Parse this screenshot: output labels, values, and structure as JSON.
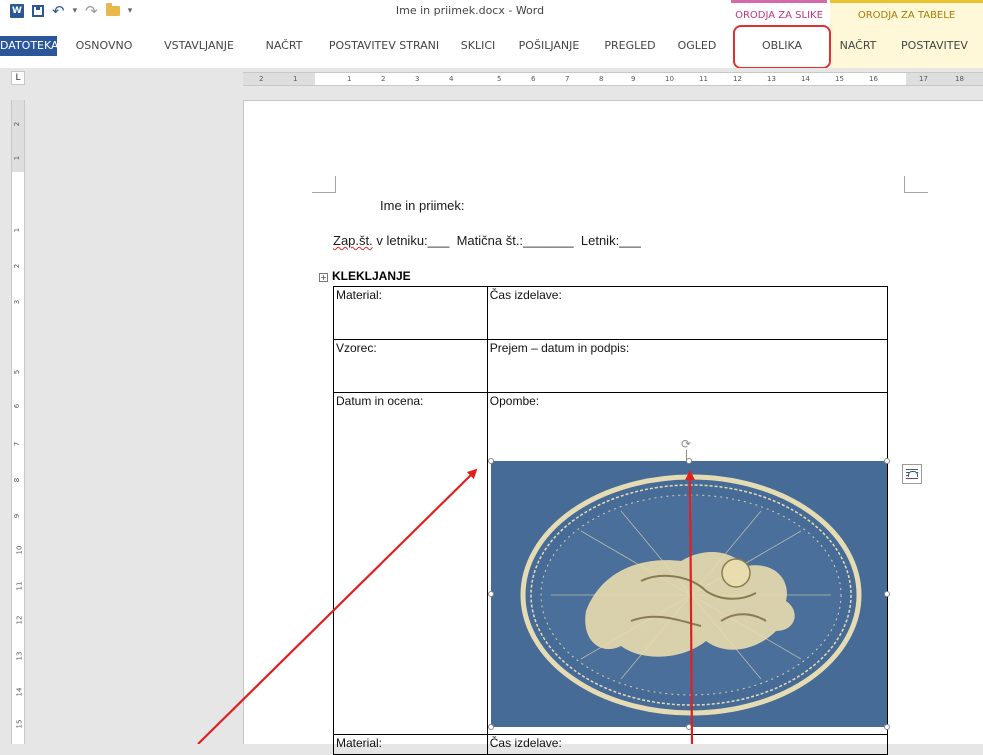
{
  "window": {
    "title": "Ime in priimek.docx - Word"
  },
  "quick_access": [
    {
      "name": "word-logo-icon",
      "glyph": "W"
    },
    {
      "name": "save-icon",
      "glyph": ""
    },
    {
      "name": "undo-icon",
      "glyph": "↶"
    },
    {
      "name": "undo-dropdown-icon",
      "glyph": "▾"
    },
    {
      "name": "redo-icon",
      "glyph": "↷"
    },
    {
      "name": "open-folder-icon",
      "glyph": ""
    },
    {
      "name": "customize-dropdown-icon",
      "glyph": "▾"
    }
  ],
  "context_groups": {
    "picture_tools": "ORODJA ZA SLIKE",
    "table_tools": "ORODJA ZA TABELE"
  },
  "ribbon_tabs": [
    "DATOTEKA",
    "OSNOVNO",
    "VSTAVLJANJE",
    "NAČRT",
    "POSTAVITEV STRANI",
    "SKLICI",
    "POŠILJANJE",
    "PREGLED",
    "OGLED",
    "OBLIKA",
    "NAČRT",
    "POSTAVITEV"
  ],
  "ruler": {
    "corner": "L",
    "h_labels": [
      "2",
      "1",
      "1",
      "2",
      "3",
      "4",
      "5",
      "6",
      "7",
      "8",
      "9",
      "10",
      "11",
      "12",
      "13",
      "14",
      "15",
      "16",
      "17",
      "18"
    ],
    "v_labels": [
      "2",
      "1",
      "1",
      "2",
      "3",
      "5",
      "6",
      "7",
      "8",
      "9",
      "10",
      "11",
      "12",
      "13",
      "14",
      "15"
    ]
  },
  "document": {
    "line1": "Ime in priimek:",
    "line2_part1": "Zap.št.",
    "line2_part2": " v letniku:___  Matična št.:_______  Letnik:___",
    "heading": "KLEKLJANJE",
    "table_move_handle": "+",
    "rows": [
      {
        "left": "Material:",
        "right": "Čas izdelave:"
      },
      {
        "left": "Vzorec:",
        "right": "Prejem – datum in podpis:"
      },
      {
        "left": "Datum in ocena:",
        "right": "Opombe:"
      },
      {
        "left": "Material:",
        "right": "Čas izdelave:"
      }
    ]
  },
  "colors": {
    "accent": "#2b579a",
    "highlight_box": "#e23030",
    "arrow": "#e02020",
    "picture_background": "#3f6592",
    "lace": "#e6dcb4"
  }
}
